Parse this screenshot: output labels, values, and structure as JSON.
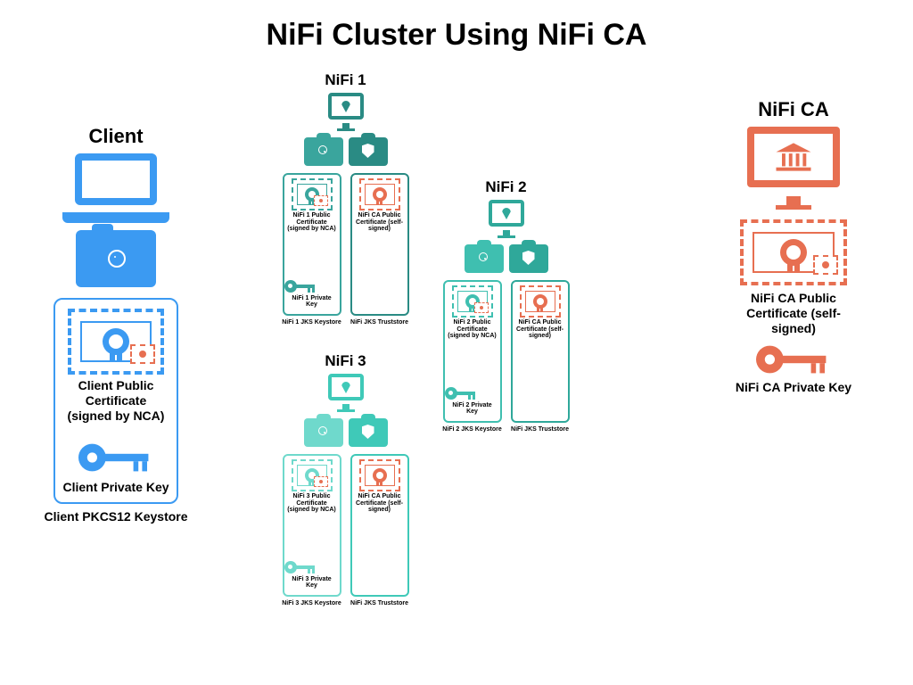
{
  "title": "NiFi Cluster Using NiFi CA",
  "client": {
    "heading": "Client",
    "cert_label": "Client Public Certificate (signed by NCA)",
    "key_label": "Client Private Key",
    "keystore_label": "Client PKCS12 Keystore"
  },
  "ca": {
    "heading": "NiFi CA",
    "cert_label": "NiFi CA Public Certificate (self-signed)",
    "key_label": "NiFi CA Private Key"
  },
  "nodes": [
    {
      "heading": "NiFi 1",
      "keystore_label": "NiFi 1 JKS Keystore",
      "truststore_label": "NiFi JKS Truststore",
      "cert_label": "NiFi 1 Public Certificate (signed by NCA)",
      "ca_cert_label": "NiFi CA Public Certificate (self-signed)",
      "key_label": "NiFi 1 Private Key",
      "color_main": "#2a8b84",
      "color_alt": "#3aa59d"
    },
    {
      "heading": "NiFi 2",
      "keystore_label": "NiFi 2 JKS Keystore",
      "truststore_label": "NiFi JKS Truststore",
      "cert_label": "NiFi 2 Public Certificate (signed by NCA)",
      "ca_cert_label": "NiFi CA Public Certificate (self-signed)",
      "key_label": "NiFi 2 Private Key",
      "color_main": "#2fa89a",
      "color_alt": "#3fbfb0"
    },
    {
      "heading": "NiFi 3",
      "keystore_label": "NiFi 3 JKS Keystore",
      "truststore_label": "NiFi JKS Truststore",
      "cert_label": "NiFi 3 Public Certificate (signed by NCA)",
      "ca_cert_label": "NiFi CA Public Certificate (self-signed)",
      "key_label": "NiFi 3 Private Key",
      "color_main": "#3fc9b8",
      "color_alt": "#6fd9cc"
    }
  ],
  "colors": {
    "client": "#3b9af2",
    "ca": "#e76f51"
  }
}
